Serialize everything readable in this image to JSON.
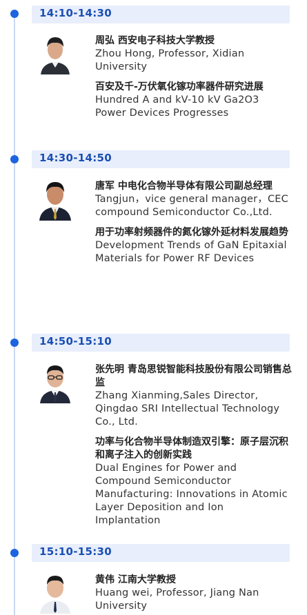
{
  "sessions": [
    {
      "time": "14:10-14:30",
      "speaker_cn": "周弘 西安电子科技大学教授",
      "speaker_en": "Zhou Hong, Professor, Xidian University",
      "talk_cn": "百安及千-万伏氧化镓功率器件研究进展",
      "talk_en": "Hundred A and kV-10 kV Ga2O3 Power Devices Progresses",
      "avatar_icon": "person-photo-icon"
    },
    {
      "time": "14:30-14:50",
      "speaker_cn": "唐军 中电化合物半导体有限公司副总经理",
      "speaker_en": "Tangjun，vice general manager，CEC compound Semiconductor Co.,Ltd.",
      "talk_cn": "用于功率射频器件的氮化镓外延材料发展趋势",
      "talk_en": "Development Trends of GaN Epitaxial Materials for Power RF Devices",
      "avatar_icon": "person-photo-icon"
    },
    {
      "time": "14:50-15:10",
      "speaker_cn": "张先明 青岛思锐智能科技股份有限公司销售总监",
      "speaker_en": "Zhang Xianming,Sales Director, Qingdao SRI Intellectual Technology Co., Ltd.",
      "talk_cn": "功率与化合物半导体制造双引擎：原子层沉积和离子注入的创新实践",
      "talk_en": "Dual Engines for Power and Compound Semiconductor Manufacturing: Innovations in Atomic Layer Deposition and Ion Implantation",
      "avatar_icon": "person-photo-icon"
    },
    {
      "time": "15:10-15:30",
      "speaker_cn": "黄伟 江南大学教授",
      "speaker_en": "Huang wei, Professor, Jiang Nan University",
      "avatar_icon": "person-photo-icon"
    }
  ],
  "colors": {
    "accent": "#1d64e0",
    "time_bar": "#e8eefb",
    "time_text": "#1a4fb3",
    "timeline": "#c9d8f3"
  }
}
